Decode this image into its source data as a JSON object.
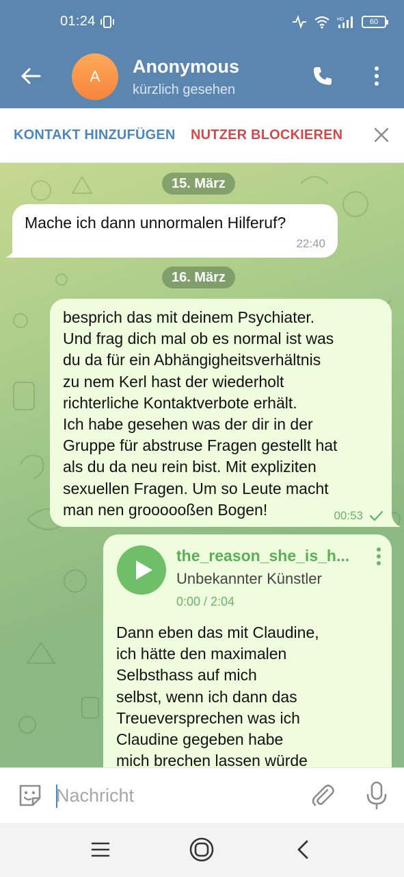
{
  "status_bar": {
    "time": "01:24",
    "battery": "60",
    "icons": [
      "vibrate-icon",
      "activity-icon",
      "wifi-icon",
      "hd-signal-icon",
      "battery-icon"
    ]
  },
  "header": {
    "avatar_letter": "A",
    "name": "Anonymous",
    "status": "kürzlich gesehen",
    "color": "#5b86b0"
  },
  "action_bar": {
    "add_contact": "KONTAKT HINZUFÜGEN",
    "block_user": "NUTZER BLOCKIEREN"
  },
  "messages": {
    "date_1": "15. März",
    "incoming": {
      "text": "Mache ich dann unnormalen Hilferuf?",
      "time": "22:40"
    },
    "date_2": "16. März",
    "outgoing": {
      "lines": [
        "besprich das mit deinem Psychiater.",
        "Und frag dich mal ob es normal ist was",
        "du da für ein Abhängigheitsverhältnis",
        "zu nem Kerl hast der wiederholt",
        "richterliche Kontaktverbote erhält.",
        "Ich habe gesehen was der dir in der",
        "Gruppe für abstruse Fragen gestellt hat",
        "als du da neu rein bist. Mit expliziten",
        "sexuellen Fragen. Um so Leute macht",
        "man nen groooooßen Bogen!"
      ],
      "time": "00:53",
      "status": "sent"
    },
    "audio": {
      "title": "the_reason_she_is_h...",
      "artist": "Unbekannter Künstler",
      "duration": "0:00 / 2:04",
      "caption_lines": [
        "Dann eben das mit Claudine,",
        "ich hätte den maximalen",
        "Selbsthass auf mich",
        "selbst, wenn ich dann das",
        "Treueversprechen was ich",
        "Claudine gegeben habe",
        "mich brechen lassen würde"
      ]
    }
  },
  "composer": {
    "placeholder": "Nachricht"
  },
  "colors": {
    "accent": "#4a87c0",
    "danger": "#d14a4a",
    "outgoing_bubble": "#effdde",
    "green": "#6fbf69"
  }
}
